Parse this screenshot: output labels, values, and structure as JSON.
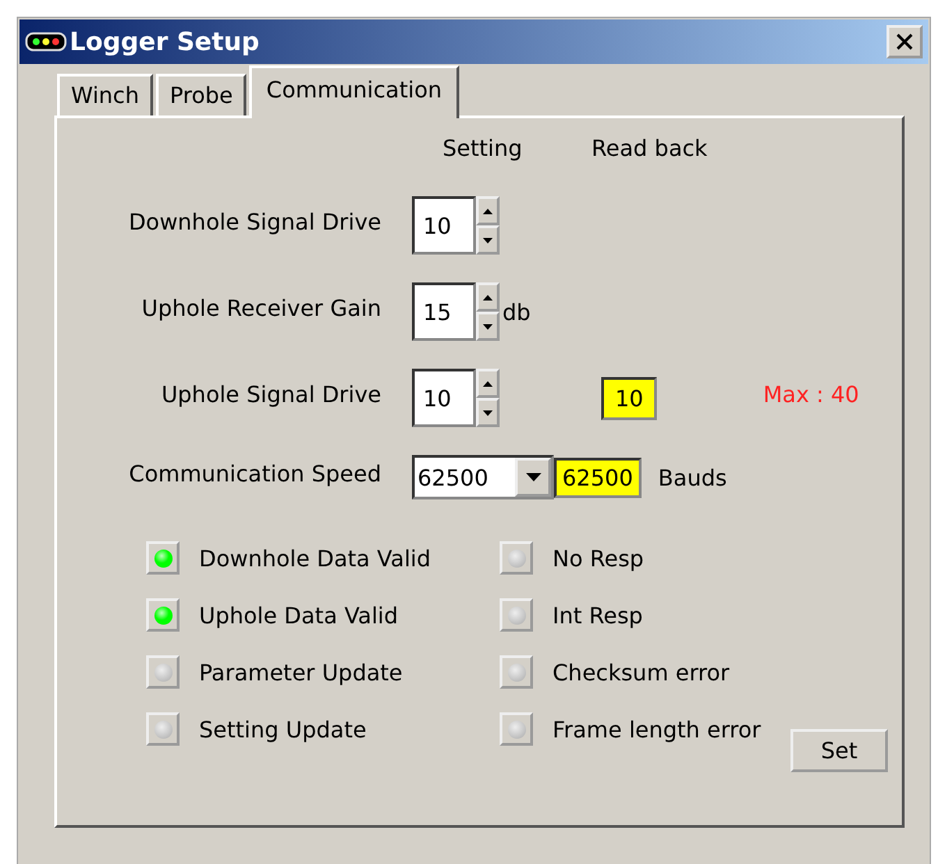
{
  "window": {
    "title": "Logger Setup"
  },
  "tabs": [
    {
      "label": "Winch",
      "selected": false
    },
    {
      "label": "Probe",
      "selected": false
    },
    {
      "label": "Communication",
      "selected": true
    }
  ],
  "columns": [
    "Setting",
    "Read back"
  ],
  "settings": [
    {
      "kind": "spinner",
      "label": "Downhole Signal Drive",
      "value": "10"
    },
    {
      "kind": "spinner",
      "label": "Uphole Receiver Gain",
      "value": "15",
      "unit": "db"
    },
    {
      "kind": "spinner",
      "label": "Uphole Signal Drive",
      "value": "10",
      "readback": "10",
      "note": "Max : 40"
    },
    {
      "kind": "dropdown",
      "label": "Communication Speed",
      "value": "62500",
      "readback": "62500",
      "unit": "Bauds"
    }
  ],
  "indicator_columns": [
    [
      {
        "label": "Downhole Data Valid",
        "on": true
      },
      {
        "label": "Uphole Data Valid",
        "on": true
      },
      {
        "label": "Parameter Update",
        "on": false
      },
      {
        "label": "Setting Update",
        "on": false
      }
    ],
    [
      {
        "label": "No Resp",
        "on": false
      },
      {
        "label": "Int Resp",
        "on": false
      },
      {
        "label": "Checksum error",
        "on": false
      },
      {
        "label": "Frame length error",
        "on": false
      }
    ]
  ],
  "buttons": [
    "Set"
  ]
}
